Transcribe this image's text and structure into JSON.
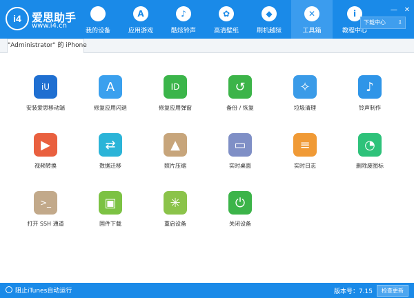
{
  "app": {
    "title": "爱思助手",
    "url": "www.i4.cn",
    "badge": "i4"
  },
  "nav": [
    {
      "label": "我的设备",
      "icon": "apple-icon",
      "glyph": ""
    },
    {
      "label": "应用游戏",
      "icon": "appstore-icon",
      "glyph": "A"
    },
    {
      "label": "酷炫铃声",
      "icon": "bell-icon",
      "glyph": "♪"
    },
    {
      "label": "高清壁纸",
      "icon": "flower-icon",
      "glyph": "✿"
    },
    {
      "label": "刷机越狱",
      "icon": "dropbox-icon",
      "glyph": "◆"
    },
    {
      "label": "工具箱",
      "icon": "tools-icon",
      "glyph": "✕",
      "active": true
    },
    {
      "label": "教程中心",
      "icon": "info-icon",
      "glyph": "i"
    }
  ],
  "window": {
    "minimize": "—",
    "close": "✕"
  },
  "download": {
    "label": "下载中心",
    "arrow": "⇩"
  },
  "device": {
    "tab_label": "\"Administrator\" 的 iPhone"
  },
  "tools": [
    {
      "label": "安装爱思移动端",
      "icon": "i4-icon",
      "glyph": "iU",
      "color": "#1f6fd1"
    },
    {
      "label": "修复应用闪退",
      "icon": "appstore-repair-icon",
      "glyph": "A",
      "color": "#3aa0ee"
    },
    {
      "label": "修复应用弹窗",
      "icon": "apple-id-icon",
      "glyph": "ID",
      "color": "#3bb54a"
    },
    {
      "label": "备份 / 恢复",
      "icon": "backup-restore-icon",
      "glyph": "↺",
      "color": "#3cb449"
    },
    {
      "label": "垃圾清理",
      "icon": "broom-icon",
      "glyph": "✧",
      "color": "#3a9be8"
    },
    {
      "label": "铃声制作",
      "icon": "bell-plus-icon",
      "glyph": "♪",
      "color": "#2f95e8"
    },
    {
      "label": "视频转换",
      "icon": "video-play-icon",
      "glyph": "▶",
      "color": "#e9603f"
    },
    {
      "label": "数据迁移",
      "icon": "data-transfer-icon",
      "glyph": "⇄",
      "color": "#2bb4d8"
    },
    {
      "label": "照片压缩",
      "icon": "photo-icon",
      "glyph": "▲",
      "color": "#c7a57b"
    },
    {
      "label": "实时桌面",
      "icon": "monitor-icon",
      "glyph": "▭",
      "color": "#7f8fc6"
    },
    {
      "label": "实时日志",
      "icon": "log-document-icon",
      "glyph": "≡",
      "color": "#f09a36"
    },
    {
      "label": "删除废图标",
      "icon": "pie-icon",
      "glyph": "◔",
      "color": "#2ec27a"
    },
    {
      "label": "打开 SSH 通道",
      "icon": "terminal-icon",
      "glyph": ">_",
      "color": "#c2a98a"
    },
    {
      "label": "固件下载",
      "icon": "firmware-box-icon",
      "glyph": "▣",
      "color": "#7cc243"
    },
    {
      "label": "重启设备",
      "icon": "restart-icon",
      "glyph": "✳",
      "color": "#8bc34a"
    },
    {
      "label": "关闭设备",
      "icon": "power-icon",
      "glyph": "⏻",
      "color": "#3cb449"
    }
  ],
  "status": {
    "itunes_label": "阻止iTunes自动运行",
    "version_label": "版本号：7.15",
    "update_button": "检查更新"
  }
}
